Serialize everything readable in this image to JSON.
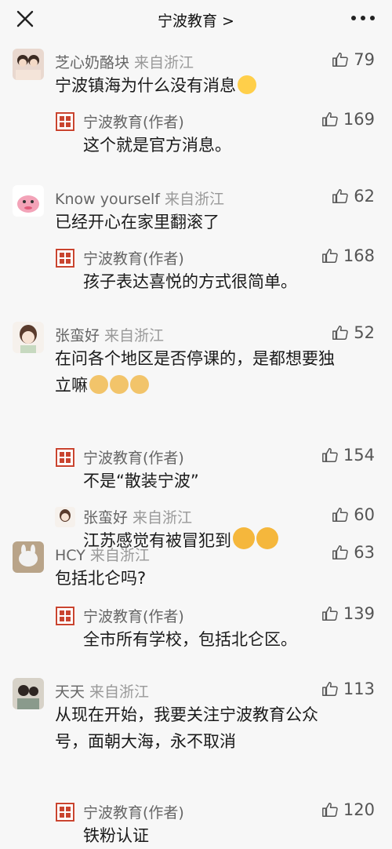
{
  "header": {
    "title": "宁波教育 >"
  },
  "comments": [
    {
      "name": "芝心奶酪块",
      "region": "来自浙江",
      "likes": "79",
      "text": "宁波镇海为什么没有消息",
      "reply": {
        "name": "宁波教育(作者)",
        "likes": "169",
        "text": "这个就是官方消息。"
      }
    },
    {
      "name": "Know yourself",
      "region": "来自浙江",
      "likes": "62",
      "text": "已经开心在家里翻滚了",
      "reply": {
        "name": "宁波教育(作者)",
        "likes": "168",
        "text": "孩子表达喜悦的方式很简单。"
      }
    },
    {
      "name": "张蛮好",
      "region": "来自浙江",
      "likes": "52",
      "text_line1": "在问各个地区是否停课的，是都想要独",
      "text_line2": "立嘛",
      "reply": {
        "name": "宁波教育(作者)",
        "likes": "154",
        "text": "不是“散装宁波”"
      },
      "reply2": {
        "name": "张蛮好",
        "region": "来自浙江",
        "likes": "60",
        "text": "江苏感觉有被冒犯到"
      }
    },
    {
      "name": "HCY",
      "region": "来自浙江",
      "likes": "63",
      "text": "包括北仑吗?",
      "reply": {
        "name": "宁波教育(作者)",
        "likes": "139",
        "text": "全市所有学校，包括北仑区。"
      }
    },
    {
      "name": "天天",
      "region": "来自浙江",
      "likes": "113",
      "text_line1": "从现在开始，我要关注宁波教育公众",
      "text_line2": "号，面朝大海，永不取消",
      "reply": {
        "name": "宁波教育(作者)",
        "likes": "120",
        "text": "铁粉认证"
      }
    }
  ],
  "colors": {
    "background": "#f7f7f7",
    "author_seal": "#c9442f",
    "name_gray": "#666666"
  }
}
